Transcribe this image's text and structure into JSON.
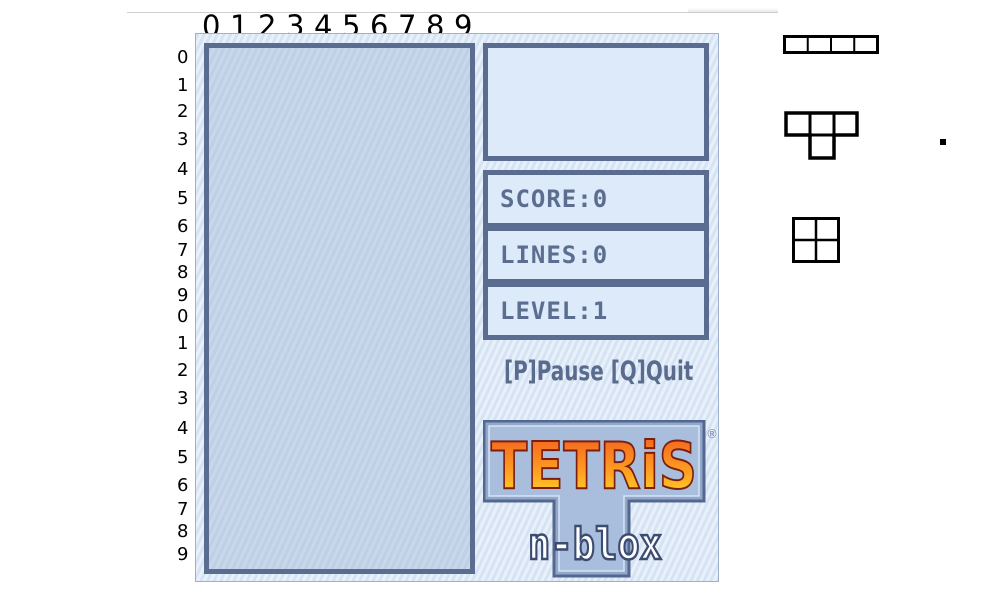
{
  "column_labels": [
    "0",
    "1",
    "2",
    "3",
    "4",
    "5",
    "6",
    "7",
    "8",
    "9"
  ],
  "row_labels": [
    "0",
    "1",
    "2",
    "3",
    "4",
    "5",
    "6",
    "7",
    "8",
    "9",
    "0",
    "1",
    "2",
    "3",
    "4",
    "5",
    "6",
    "7",
    "8",
    "9"
  ],
  "stats": {
    "score_label": "SCORE:0",
    "lines_label": "LINES:0",
    "level_label": "LEVEL:1"
  },
  "controls_text": "[P]Pause [Q]Quit",
  "logo": {
    "title": "TETRiS",
    "subtitle": "n-blox",
    "registered_mark": "®"
  },
  "colors": {
    "panel_border": "#5a6c90",
    "panel_fill": "#ddeafa",
    "playfield_fill": "#c3d2e8",
    "text": "#5b6e8f",
    "logo_gradient_top": "#f05a1e",
    "logo_gradient_bottom": "#ffe12a"
  },
  "pieces": [
    {
      "name": "I-piece",
      "icon": "i-tetromino-icon"
    },
    {
      "name": "T-piece",
      "icon": "t-tetromino-icon"
    },
    {
      "name": "O-piece",
      "icon": "o-tetromino-icon"
    }
  ]
}
